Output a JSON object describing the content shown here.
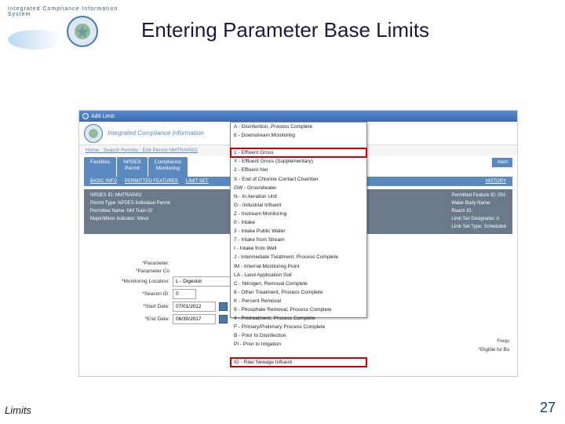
{
  "header": {
    "icis_label": "Integrated Compliance Information System",
    "title": "Entering Parameter Base Limits"
  },
  "screenshot": {
    "titlebar": "Add Limit:",
    "inner_icis": "Integrated Compliance Information",
    "breadcrumb": "Home : Search Permits : Edit Permit NMTRAIN02",
    "tabs": [
      "Facilities",
      "NPDES\nPermit",
      "Compliance\nMonitoring"
    ],
    "right_tab": "ment",
    "right_link": "HISTORY",
    "subnav": [
      "BASIC INFO",
      "PERMITTED FEATURES",
      "LIMIT SET"
    ],
    "info_left": [
      "NPDES ID: NMTRAIN02",
      "Permit Type: NPDES Individual Permit",
      "Permittee Name: NM Train 02",
      "Major/Minor Indicator: Minor"
    ],
    "info_right": [
      "Permitted Feature ID: 001",
      "Water Body Name:",
      "Reach ID:",
      "Limit Set Designator: A",
      "Limit Set Type: Scheduled"
    ],
    "form": {
      "parameter_label": "*Parameter:",
      "parameter_code_label": "*Parameter Co",
      "monitoring_loc_label": "*Monitoring Location:",
      "monitoring_loc_value": "L - Digestor",
      "season_label": "*Season ID:",
      "season_value": "0",
      "start_label": "*Start Date:",
      "start_value": "07/01/2012",
      "end_label": "*End Date:",
      "end_value": "06/30/2017"
    },
    "right_notes": {
      "freq": "Frequ",
      "eligible": "*Eligible for Bu"
    },
    "dropdown_items": [
      "A - Disinfection, Process Complete",
      "6 - Downstream Monitoring",
      "",
      "1 - Effluent Gross",
      "Y - Effluent Gross (Supplementary)",
      "2 - Effluent Net",
      "X - End of Chlorine Contact Chamber",
      "GW - Groundwater",
      "N - In Aeration Unit",
      "G - Industrial Influent",
      "Z - Instream Monitoring",
      "0 - Intake",
      "3 - Intake Public Water",
      "7 - Intake from Stream",
      "I - Intake from Well",
      "J - Intermediate Treatment, Process Complete",
      "IM - Internal Monitoring Point",
      "LA - Land Application Soil",
      "C - Nitrogen, Removal Complete",
      "8 - Other Treatment, Process Complete",
      "K - Percent Removal",
      "9 - Phosphate Removal, Process Complete",
      "4 - Pretreatment, Process Complete",
      "F - Primary/Prelimary Process Complete",
      "B - Prior to Disinfection",
      "PI - Prior to Irrigation",
      "",
      "IG - Raw Sewage Influent"
    ]
  },
  "footer": {
    "left": "Limits",
    "right": "27"
  }
}
